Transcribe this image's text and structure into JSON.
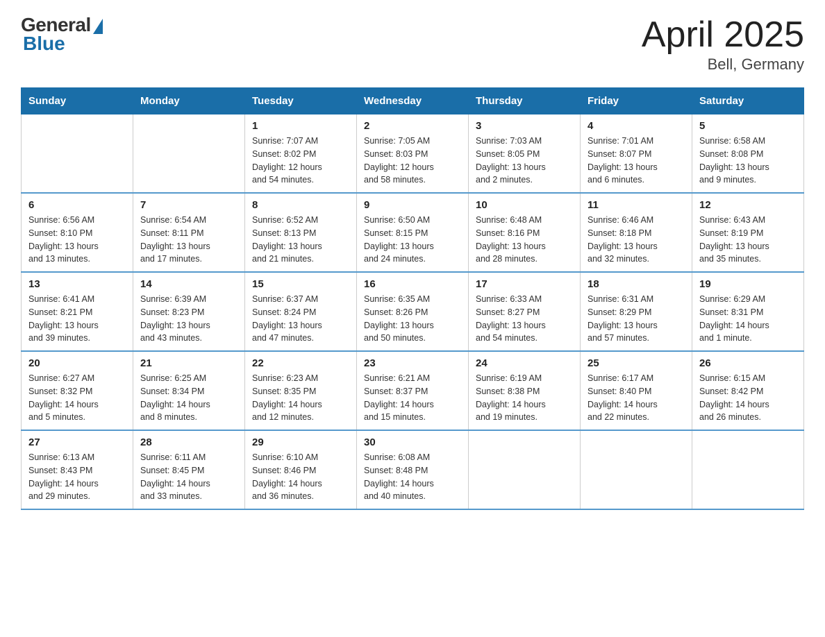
{
  "logo": {
    "general": "General",
    "blue": "Blue"
  },
  "title": "April 2025",
  "subtitle": "Bell, Germany",
  "weekdays": [
    "Sunday",
    "Monday",
    "Tuesday",
    "Wednesday",
    "Thursday",
    "Friday",
    "Saturday"
  ],
  "weeks": [
    [
      {
        "day": "",
        "info": ""
      },
      {
        "day": "",
        "info": ""
      },
      {
        "day": "1",
        "info": "Sunrise: 7:07 AM\nSunset: 8:02 PM\nDaylight: 12 hours\nand 54 minutes."
      },
      {
        "day": "2",
        "info": "Sunrise: 7:05 AM\nSunset: 8:03 PM\nDaylight: 12 hours\nand 58 minutes."
      },
      {
        "day": "3",
        "info": "Sunrise: 7:03 AM\nSunset: 8:05 PM\nDaylight: 13 hours\nand 2 minutes."
      },
      {
        "day": "4",
        "info": "Sunrise: 7:01 AM\nSunset: 8:07 PM\nDaylight: 13 hours\nand 6 minutes."
      },
      {
        "day": "5",
        "info": "Sunrise: 6:58 AM\nSunset: 8:08 PM\nDaylight: 13 hours\nand 9 minutes."
      }
    ],
    [
      {
        "day": "6",
        "info": "Sunrise: 6:56 AM\nSunset: 8:10 PM\nDaylight: 13 hours\nand 13 minutes."
      },
      {
        "day": "7",
        "info": "Sunrise: 6:54 AM\nSunset: 8:11 PM\nDaylight: 13 hours\nand 17 minutes."
      },
      {
        "day": "8",
        "info": "Sunrise: 6:52 AM\nSunset: 8:13 PM\nDaylight: 13 hours\nand 21 minutes."
      },
      {
        "day": "9",
        "info": "Sunrise: 6:50 AM\nSunset: 8:15 PM\nDaylight: 13 hours\nand 24 minutes."
      },
      {
        "day": "10",
        "info": "Sunrise: 6:48 AM\nSunset: 8:16 PM\nDaylight: 13 hours\nand 28 minutes."
      },
      {
        "day": "11",
        "info": "Sunrise: 6:46 AM\nSunset: 8:18 PM\nDaylight: 13 hours\nand 32 minutes."
      },
      {
        "day": "12",
        "info": "Sunrise: 6:43 AM\nSunset: 8:19 PM\nDaylight: 13 hours\nand 35 minutes."
      }
    ],
    [
      {
        "day": "13",
        "info": "Sunrise: 6:41 AM\nSunset: 8:21 PM\nDaylight: 13 hours\nand 39 minutes."
      },
      {
        "day": "14",
        "info": "Sunrise: 6:39 AM\nSunset: 8:23 PM\nDaylight: 13 hours\nand 43 minutes."
      },
      {
        "day": "15",
        "info": "Sunrise: 6:37 AM\nSunset: 8:24 PM\nDaylight: 13 hours\nand 47 minutes."
      },
      {
        "day": "16",
        "info": "Sunrise: 6:35 AM\nSunset: 8:26 PM\nDaylight: 13 hours\nand 50 minutes."
      },
      {
        "day": "17",
        "info": "Sunrise: 6:33 AM\nSunset: 8:27 PM\nDaylight: 13 hours\nand 54 minutes."
      },
      {
        "day": "18",
        "info": "Sunrise: 6:31 AM\nSunset: 8:29 PM\nDaylight: 13 hours\nand 57 minutes."
      },
      {
        "day": "19",
        "info": "Sunrise: 6:29 AM\nSunset: 8:31 PM\nDaylight: 14 hours\nand 1 minute."
      }
    ],
    [
      {
        "day": "20",
        "info": "Sunrise: 6:27 AM\nSunset: 8:32 PM\nDaylight: 14 hours\nand 5 minutes."
      },
      {
        "day": "21",
        "info": "Sunrise: 6:25 AM\nSunset: 8:34 PM\nDaylight: 14 hours\nand 8 minutes."
      },
      {
        "day": "22",
        "info": "Sunrise: 6:23 AM\nSunset: 8:35 PM\nDaylight: 14 hours\nand 12 minutes."
      },
      {
        "day": "23",
        "info": "Sunrise: 6:21 AM\nSunset: 8:37 PM\nDaylight: 14 hours\nand 15 minutes."
      },
      {
        "day": "24",
        "info": "Sunrise: 6:19 AM\nSunset: 8:38 PM\nDaylight: 14 hours\nand 19 minutes."
      },
      {
        "day": "25",
        "info": "Sunrise: 6:17 AM\nSunset: 8:40 PM\nDaylight: 14 hours\nand 22 minutes."
      },
      {
        "day": "26",
        "info": "Sunrise: 6:15 AM\nSunset: 8:42 PM\nDaylight: 14 hours\nand 26 minutes."
      }
    ],
    [
      {
        "day": "27",
        "info": "Sunrise: 6:13 AM\nSunset: 8:43 PM\nDaylight: 14 hours\nand 29 minutes."
      },
      {
        "day": "28",
        "info": "Sunrise: 6:11 AM\nSunset: 8:45 PM\nDaylight: 14 hours\nand 33 minutes."
      },
      {
        "day": "29",
        "info": "Sunrise: 6:10 AM\nSunset: 8:46 PM\nDaylight: 14 hours\nand 36 minutes."
      },
      {
        "day": "30",
        "info": "Sunrise: 6:08 AM\nSunset: 8:48 PM\nDaylight: 14 hours\nand 40 minutes."
      },
      {
        "day": "",
        "info": ""
      },
      {
        "day": "",
        "info": ""
      },
      {
        "day": "",
        "info": ""
      }
    ]
  ]
}
